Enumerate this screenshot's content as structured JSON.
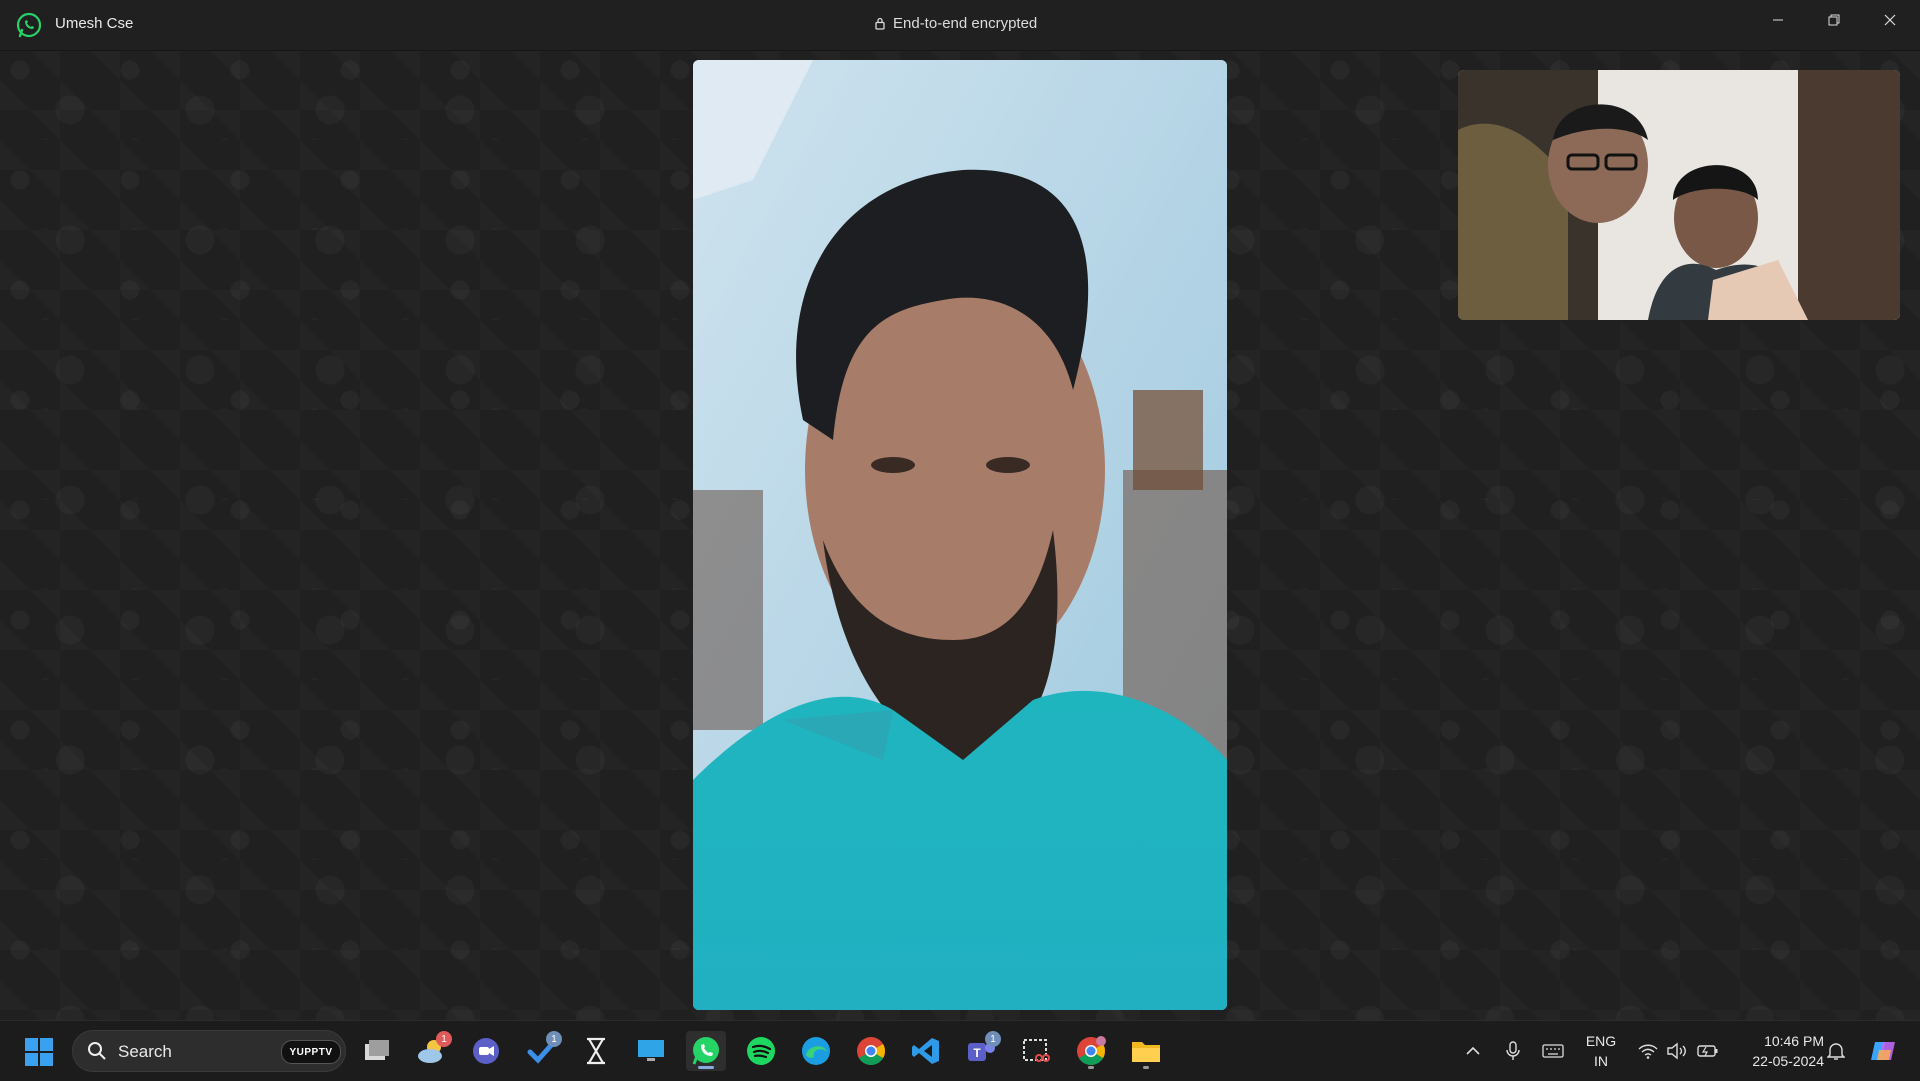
{
  "window": {
    "contact_name": "Umesh Cse",
    "encryption_label": "End-to-end encrypted"
  },
  "call": {
    "remote_video": "remote-participant-video",
    "self_video": "self-preview-video"
  },
  "taskbar": {
    "search_label": "Search",
    "search_badge": "YUPPTV",
    "apps": [
      {
        "name": "task-view-icon",
        "badge": ""
      },
      {
        "name": "weather-icon",
        "badge": "1"
      },
      {
        "name": "zoom-icon",
        "badge": ""
      },
      {
        "name": "todo-icon",
        "badge": "1"
      },
      {
        "name": "hourglass-icon",
        "badge": ""
      },
      {
        "name": "desktop-icon",
        "badge": ""
      },
      {
        "name": "whatsapp-icon",
        "badge": ""
      },
      {
        "name": "spotify-icon",
        "badge": ""
      },
      {
        "name": "edge-icon",
        "badge": ""
      },
      {
        "name": "chrome-icon",
        "badge": ""
      },
      {
        "name": "vscode-icon",
        "badge": ""
      },
      {
        "name": "teams-icon",
        "badge": "1"
      },
      {
        "name": "snipping-tool-icon",
        "badge": ""
      },
      {
        "name": "chrome-profile-icon",
        "badge": ""
      },
      {
        "name": "file-explorer-icon",
        "badge": ""
      }
    ],
    "language": [
      "ENG",
      "IN"
    ],
    "time": "10:46 PM",
    "date": "22-05-2024"
  },
  "colors": {
    "accent_whatsapp": "#25D366",
    "background": "#202020",
    "taskbar": "#1c1c1c"
  }
}
